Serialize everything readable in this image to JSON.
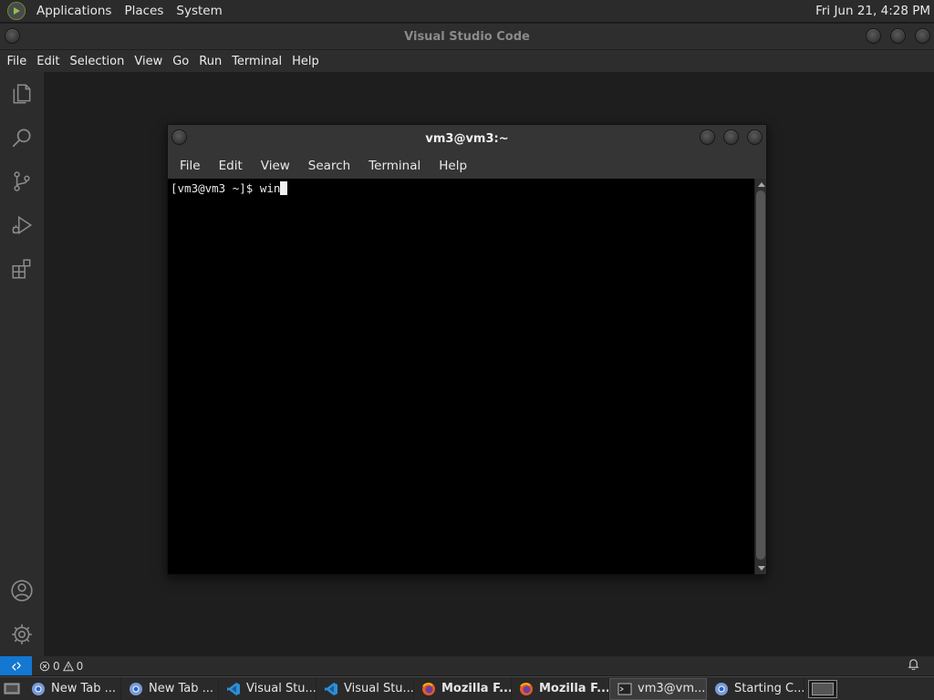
{
  "top_panel": {
    "menus": [
      "Applications",
      "Places",
      "System"
    ],
    "clock": "Fri Jun 21,  4:28 PM"
  },
  "window": {
    "title": "Visual Studio Code"
  },
  "vscode_menu": [
    "File",
    "Edit",
    "Selection",
    "View",
    "Go",
    "Run",
    "Terminal",
    "Help"
  ],
  "activity_bar": {
    "top_icons": [
      "explorer-icon",
      "search-icon",
      "source-control-icon",
      "run-debug-icon",
      "extensions-icon"
    ],
    "bottom_icons": [
      "account-icon",
      "settings-gear-icon"
    ]
  },
  "status_bar": {
    "errors": "0",
    "warnings": "0",
    "accent": "#1477d1"
  },
  "terminal": {
    "title": "vm3@vm3:~",
    "menu": [
      "File",
      "Edit",
      "View",
      "Search",
      "Terminal",
      "Help"
    ],
    "prompt": "[vm3@vm3 ~]$ ",
    "input": "win"
  },
  "taskbar": {
    "tasks": [
      {
        "label": "New Tab ...",
        "icon": "chrome-icon",
        "bold": false,
        "active": false
      },
      {
        "label": "New Tab ...",
        "icon": "chrome-icon",
        "bold": false,
        "active": false
      },
      {
        "label": "Visual Stu...",
        "icon": "vscode-icon",
        "bold": false,
        "active": false
      },
      {
        "label": "Visual Stu...",
        "icon": "vscode-icon",
        "bold": false,
        "active": false
      },
      {
        "label": "Mozilla F...",
        "icon": "firefox-icon",
        "bold": true,
        "active": false
      },
      {
        "label": "Mozilla F...",
        "icon": "firefox-icon",
        "bold": true,
        "active": false
      },
      {
        "label": "vm3@vm...",
        "icon": "terminal-icon",
        "bold": false,
        "active": true
      },
      {
        "label": "Starting C...",
        "icon": "chrome-icon",
        "bold": false,
        "active": false
      }
    ]
  }
}
